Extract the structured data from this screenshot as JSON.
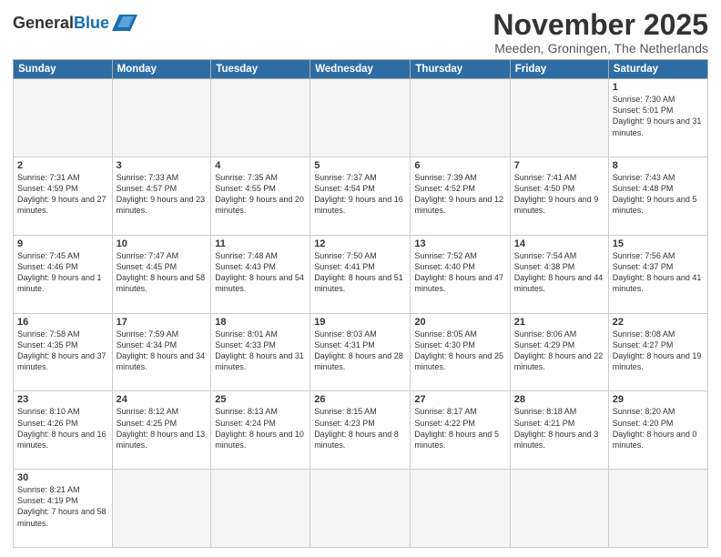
{
  "logo": {
    "general": "General",
    "blue": "Blue"
  },
  "title": "November 2025",
  "subtitle": "Meeden, Groningen, The Netherlands",
  "days_of_week": [
    "Sunday",
    "Monday",
    "Tuesday",
    "Wednesday",
    "Thursday",
    "Friday",
    "Saturday"
  ],
  "weeks": [
    [
      {
        "day": "",
        "info": "",
        "empty": true
      },
      {
        "day": "",
        "info": "",
        "empty": true
      },
      {
        "day": "",
        "info": "",
        "empty": true
      },
      {
        "day": "",
        "info": "",
        "empty": true
      },
      {
        "day": "",
        "info": "",
        "empty": true
      },
      {
        "day": "",
        "info": "",
        "empty": true
      },
      {
        "day": "1",
        "info": "Sunrise: 7:30 AM\nSunset: 5:01 PM\nDaylight: 9 hours\nand 31 minutes."
      }
    ],
    [
      {
        "day": "2",
        "info": "Sunrise: 7:31 AM\nSunset: 4:59 PM\nDaylight: 9 hours\nand 27 minutes."
      },
      {
        "day": "3",
        "info": "Sunrise: 7:33 AM\nSunset: 4:57 PM\nDaylight: 9 hours\nand 23 minutes."
      },
      {
        "day": "4",
        "info": "Sunrise: 7:35 AM\nSunset: 4:55 PM\nDaylight: 9 hours\nand 20 minutes."
      },
      {
        "day": "5",
        "info": "Sunrise: 7:37 AM\nSunset: 4:54 PM\nDaylight: 9 hours\nand 16 minutes."
      },
      {
        "day": "6",
        "info": "Sunrise: 7:39 AM\nSunset: 4:52 PM\nDaylight: 9 hours\nand 12 minutes."
      },
      {
        "day": "7",
        "info": "Sunrise: 7:41 AM\nSunset: 4:50 PM\nDaylight: 9 hours\nand 9 minutes."
      },
      {
        "day": "8",
        "info": "Sunrise: 7:43 AM\nSunset: 4:48 PM\nDaylight: 9 hours\nand 5 minutes."
      }
    ],
    [
      {
        "day": "9",
        "info": "Sunrise: 7:45 AM\nSunset: 4:46 PM\nDaylight: 9 hours\nand 1 minute."
      },
      {
        "day": "10",
        "info": "Sunrise: 7:47 AM\nSunset: 4:45 PM\nDaylight: 8 hours\nand 58 minutes."
      },
      {
        "day": "11",
        "info": "Sunrise: 7:48 AM\nSunset: 4:43 PM\nDaylight: 8 hours\nand 54 minutes."
      },
      {
        "day": "12",
        "info": "Sunrise: 7:50 AM\nSunset: 4:41 PM\nDaylight: 8 hours\nand 51 minutes."
      },
      {
        "day": "13",
        "info": "Sunrise: 7:52 AM\nSunset: 4:40 PM\nDaylight: 8 hours\nand 47 minutes."
      },
      {
        "day": "14",
        "info": "Sunrise: 7:54 AM\nSunset: 4:38 PM\nDaylight: 8 hours\nand 44 minutes."
      },
      {
        "day": "15",
        "info": "Sunrise: 7:56 AM\nSunset: 4:37 PM\nDaylight: 8 hours\nand 41 minutes."
      }
    ],
    [
      {
        "day": "16",
        "info": "Sunrise: 7:58 AM\nSunset: 4:35 PM\nDaylight: 8 hours\nand 37 minutes."
      },
      {
        "day": "17",
        "info": "Sunrise: 7:59 AM\nSunset: 4:34 PM\nDaylight: 8 hours\nand 34 minutes."
      },
      {
        "day": "18",
        "info": "Sunrise: 8:01 AM\nSunset: 4:33 PM\nDaylight: 8 hours\nand 31 minutes."
      },
      {
        "day": "19",
        "info": "Sunrise: 8:03 AM\nSunset: 4:31 PM\nDaylight: 8 hours\nand 28 minutes."
      },
      {
        "day": "20",
        "info": "Sunrise: 8:05 AM\nSunset: 4:30 PM\nDaylight: 8 hours\nand 25 minutes."
      },
      {
        "day": "21",
        "info": "Sunrise: 8:06 AM\nSunset: 4:29 PM\nDaylight: 8 hours\nand 22 minutes."
      },
      {
        "day": "22",
        "info": "Sunrise: 8:08 AM\nSunset: 4:27 PM\nDaylight: 8 hours\nand 19 minutes."
      }
    ],
    [
      {
        "day": "23",
        "info": "Sunrise: 8:10 AM\nSunset: 4:26 PM\nDaylight: 8 hours\nand 16 minutes."
      },
      {
        "day": "24",
        "info": "Sunrise: 8:12 AM\nSunset: 4:25 PM\nDaylight: 8 hours\nand 13 minutes."
      },
      {
        "day": "25",
        "info": "Sunrise: 8:13 AM\nSunset: 4:24 PM\nDaylight: 8 hours\nand 10 minutes."
      },
      {
        "day": "26",
        "info": "Sunrise: 8:15 AM\nSunset: 4:23 PM\nDaylight: 8 hours\nand 8 minutes."
      },
      {
        "day": "27",
        "info": "Sunrise: 8:17 AM\nSunset: 4:22 PM\nDaylight: 8 hours\nand 5 minutes."
      },
      {
        "day": "28",
        "info": "Sunrise: 8:18 AM\nSunset: 4:21 PM\nDaylight: 8 hours\nand 3 minutes."
      },
      {
        "day": "29",
        "info": "Sunrise: 8:20 AM\nSunset: 4:20 PM\nDaylight: 8 hours\nand 0 minutes."
      }
    ],
    [
      {
        "day": "30",
        "info": "Sunrise: 8:21 AM\nSunset: 4:19 PM\nDaylight: 7 hours\nand 58 minutes."
      },
      {
        "day": "",
        "info": "",
        "empty": true
      },
      {
        "day": "",
        "info": "",
        "empty": true
      },
      {
        "day": "",
        "info": "",
        "empty": true
      },
      {
        "day": "",
        "info": "",
        "empty": true
      },
      {
        "day": "",
        "info": "",
        "empty": true
      },
      {
        "day": "",
        "info": "",
        "empty": true
      }
    ]
  ]
}
